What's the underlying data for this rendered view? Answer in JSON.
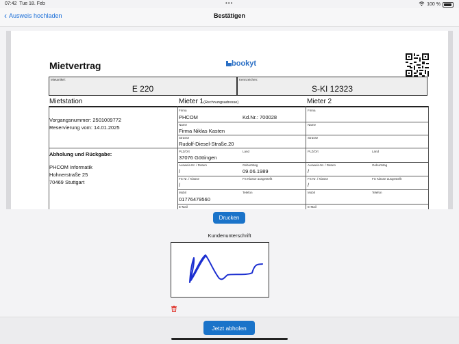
{
  "status": {
    "time": "07:42",
    "date": "Tue 18. Feb",
    "battery": "100 %"
  },
  "nav": {
    "back_label": "Ausweis hochladen",
    "title": "Bestätigen"
  },
  "document": {
    "title": "Mietvertrag",
    "logo": "bookyt",
    "mietartikel_label": "Mietartikel:",
    "mietartikel_value": "E 220",
    "kennzeichen_label": "Kennzeichen:",
    "kennzeichen_value": "S-KI 12323",
    "mietstation_heading": "Mietstation",
    "mieter1_heading": "Mieter 1",
    "mieter1_sub": "(Rechnungsadresse)",
    "mieter2_heading": "Mieter 2",
    "vorgangsnummer": "Vorgangsnummer: 2501009772",
    "reservierung": "Reservierung vom: 14.01.2025",
    "abholung_heading": "Abholung und Rückgabe:",
    "station_name": "PHCOM Informatik",
    "station_street": "Hohnerstraße 25",
    "station_city": "70469 Stuttgart",
    "labels": {
      "firma": "Firma",
      "name": "Name",
      "strasse": "Strasse",
      "plzort": "PLZ/Ort",
      "land": "Land",
      "ausweis": "Ausweis-Nr. / Datum",
      "geburtstag": "Geburtstag",
      "fs": "FS Nr. / Klasse",
      "fs_klasse": "FS Klasse ausgestellt",
      "mobil": "Mobil",
      "telefon": "Telefon",
      "email": "E-Mail"
    },
    "m1": {
      "firma": "PHCOM",
      "kdnr": "Kd.Nr.: 700028",
      "name": "Firma Niklas Kasten",
      "strasse": "Rudolf-Diesel-Straße.20",
      "plzort": "37076 Göttingen",
      "ausweis": "/",
      "geburtstag": "09.06.1989",
      "fs": "/",
      "mobil": "01776479560"
    },
    "m2": {
      "ausweis": "/",
      "fs": "/"
    }
  },
  "print_label": "Drucken",
  "signature_label": "Kundenunterschrift",
  "submit_label": "Jetzt abholen",
  "colors": {
    "accent": "#1a73c9",
    "signature": "#1c2fd0",
    "trash": "#e0342c"
  }
}
